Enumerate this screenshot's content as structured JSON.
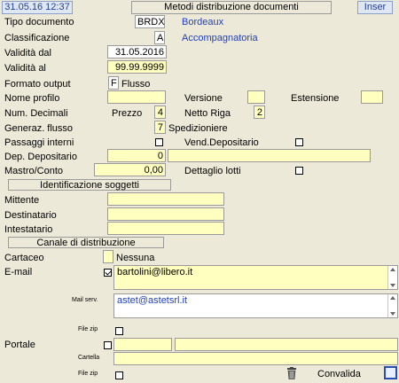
{
  "header": {
    "datetime": "31.05.16 12:37",
    "title": "Metodi distribuzione documenti",
    "mode": "Inser"
  },
  "fields": {
    "tipo_documento": {
      "label": "Tipo documento",
      "value": "BRDX",
      "desc": "Bordeaux"
    },
    "classificazione": {
      "label": "Classificazione",
      "value": "A",
      "desc": "Accompagnatoria"
    },
    "validita_dal": {
      "label": "Validità dal",
      "value": "31.05.2016"
    },
    "validita_al": {
      "label": "Validità  al",
      "value": "99.99.9999"
    },
    "formato_output": {
      "label": "Formato output",
      "value": "F",
      "desc": "Flusso"
    },
    "nome_profilo": {
      "label": "Nome profilo",
      "value": ""
    },
    "versione": {
      "label": "Versione",
      "value": ""
    },
    "estensione": {
      "label": "Estensione",
      "value": ""
    },
    "num_decimali": {
      "label": "Num. Decimali"
    },
    "prezzo": {
      "label": "Prezzo",
      "value": "4"
    },
    "netto_riga": {
      "label": "Netto Riga",
      "value": "2"
    },
    "generaz_flusso": {
      "label": "Generaz. flusso",
      "value": "7",
      "desc": "Spedizioniere"
    },
    "passaggi_interni": {
      "label": "Passaggi interni",
      "checked": false
    },
    "vend_depositario": {
      "label": "Vend.Depositario",
      "checked": false
    },
    "dep_depositario": {
      "label": "Dep. Depositario",
      "value": "0",
      "desc": ""
    },
    "mastro_conto": {
      "label": "Mastro/Conto",
      "value": "0,00"
    },
    "dettaglio_lotti": {
      "label": "Dettaglio lotti",
      "checked": false
    }
  },
  "soggetti": {
    "title": "Identificazione soggetti",
    "mittente": {
      "label": "Mittente",
      "value": ""
    },
    "destinatario": {
      "label": "Destinatario",
      "value": ""
    },
    "intestatario": {
      "label": "Intestatario",
      "value": ""
    }
  },
  "canale": {
    "title": "Canale di distribuzione",
    "cartaceo": {
      "label": "Cartaceo",
      "value": "",
      "desc": "Nessuna"
    },
    "email": {
      "label": "E-mail",
      "checked": true,
      "value": "bartolini@libero.it"
    },
    "mail_serv": {
      "label": "Mail serv.",
      "value": "astet@astetsrl.it"
    },
    "file_zip_1": {
      "label": "File zip",
      "checked": false
    },
    "portale": {
      "label": "Portale",
      "checked": false,
      "value1": "",
      "value2": ""
    },
    "cartella": {
      "label": "Cartella",
      "value": ""
    },
    "file_zip_2": {
      "label": "File zip",
      "checked": false
    },
    "convalida": {
      "label": "Convalida"
    }
  }
}
